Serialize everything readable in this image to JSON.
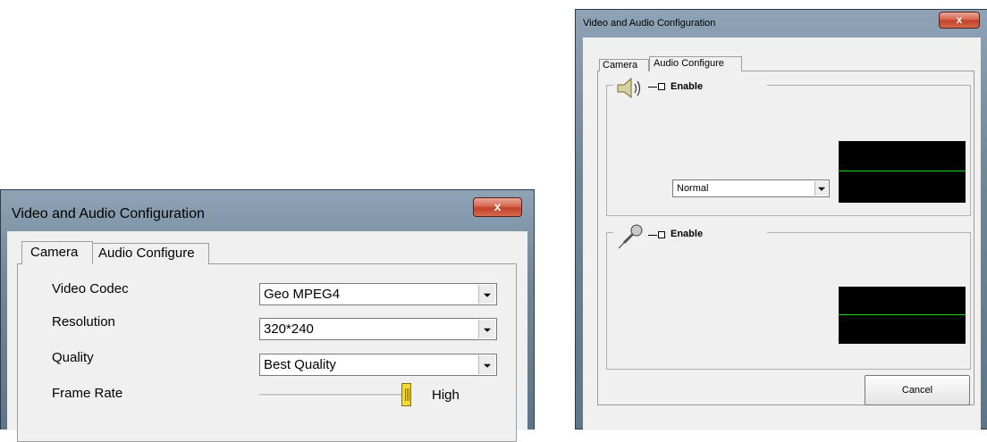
{
  "left_window": {
    "title": "Video and Audio Configuration",
    "close_label": "x",
    "tabs": [
      {
        "label": "Camera",
        "active": true
      },
      {
        "label": "Audio Configure",
        "active": false
      }
    ],
    "fields": [
      {
        "label": "Video Codec",
        "value": "Geo MPEG4"
      },
      {
        "label": "Resolution",
        "value": "320*240"
      },
      {
        "label": "Quality",
        "value": "Best Quality"
      }
    ],
    "frame_rate": {
      "label": "Frame Rate",
      "high_label": "High",
      "level": 1.0
    }
  },
  "right_window": {
    "title": "Video and Audio Configuration",
    "close_label": "x",
    "tabs": [
      {
        "label": "Camera",
        "active": false
      },
      {
        "label": "Audio Configure",
        "active": true
      }
    ],
    "speaker_group": {
      "icon": "speaker-icon",
      "checkbox_label": "Enable",
      "checked": false,
      "level_select": "Normal"
    },
    "mic_group": {
      "icon": "microphone-icon",
      "checkbox_label": "Enable",
      "checked": false
    },
    "cancel_label": "Cancel"
  },
  "colors": {
    "scope_bg": "#000000",
    "scope_line": "#1fd31f",
    "slider_thumb": "#f7d838",
    "close_button": "#c2412a"
  }
}
